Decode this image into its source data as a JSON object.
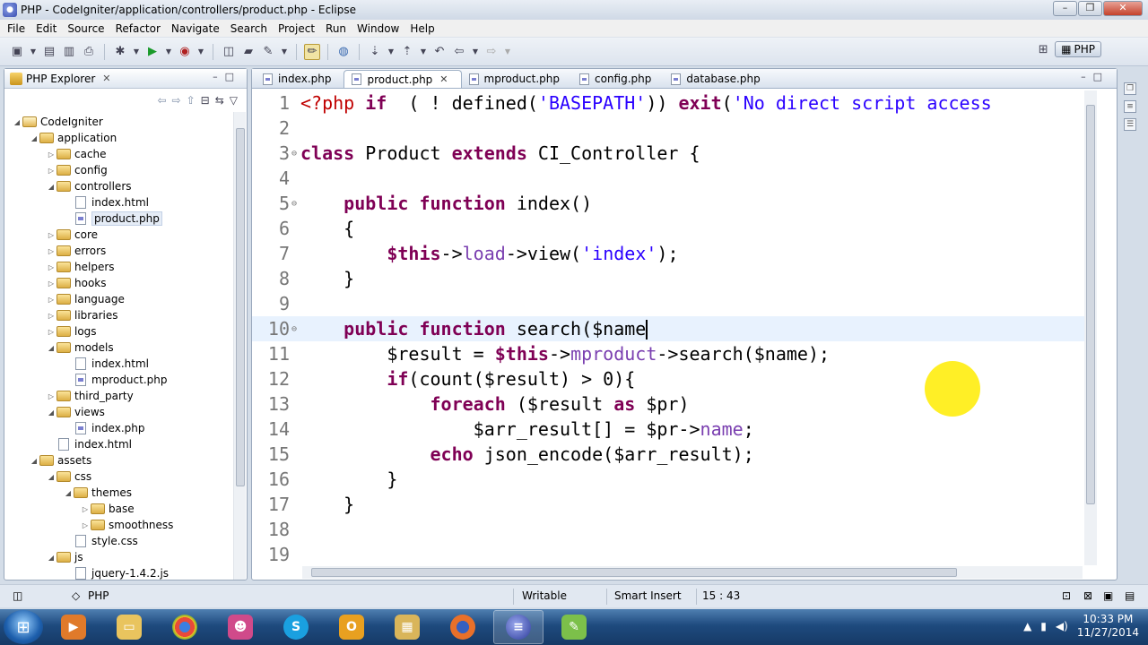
{
  "window": {
    "title": "PHP - CodeIgniter/application/controllers/product.php - Eclipse"
  },
  "menu": [
    "File",
    "Edit",
    "Source",
    "Refactor",
    "Navigate",
    "Search",
    "Project",
    "Run",
    "Window",
    "Help"
  ],
  "perspective": {
    "label": "PHP"
  },
  "explorer": {
    "tab_label": "PHP Explorer",
    "tree": [
      {
        "label": "CodeIgniter",
        "depth": 0,
        "type": "project",
        "expanded": true
      },
      {
        "label": "application",
        "depth": 1,
        "type": "folder",
        "expanded": true
      },
      {
        "label": "cache",
        "depth": 2,
        "type": "folder"
      },
      {
        "label": "config",
        "depth": 2,
        "type": "folder"
      },
      {
        "label": "controllers",
        "depth": 2,
        "type": "folder",
        "expanded": true
      },
      {
        "label": "index.html",
        "depth": 3,
        "type": "file"
      },
      {
        "label": "product.php",
        "depth": 3,
        "type": "php",
        "selected": true
      },
      {
        "label": "core",
        "depth": 2,
        "type": "folder"
      },
      {
        "label": "errors",
        "depth": 2,
        "type": "folder"
      },
      {
        "label": "helpers",
        "depth": 2,
        "type": "folder"
      },
      {
        "label": "hooks",
        "depth": 2,
        "type": "folder"
      },
      {
        "label": "language",
        "depth": 2,
        "type": "folder"
      },
      {
        "label": "libraries",
        "depth": 2,
        "type": "folder"
      },
      {
        "label": "logs",
        "depth": 2,
        "type": "folder"
      },
      {
        "label": "models",
        "depth": 2,
        "type": "folder",
        "expanded": true
      },
      {
        "label": "index.html",
        "depth": 3,
        "type": "file"
      },
      {
        "label": "mproduct.php",
        "depth": 3,
        "type": "php"
      },
      {
        "label": "third_party",
        "depth": 2,
        "type": "folder"
      },
      {
        "label": "views",
        "depth": 2,
        "type": "folder",
        "expanded": true
      },
      {
        "label": "index.php",
        "depth": 3,
        "type": "php"
      },
      {
        "label": "index.html",
        "depth": 2,
        "type": "file"
      },
      {
        "label": "assets",
        "depth": 1,
        "type": "folder",
        "expanded": true
      },
      {
        "label": "css",
        "depth": 2,
        "type": "folder",
        "expanded": true
      },
      {
        "label": "themes",
        "depth": 3,
        "type": "folder",
        "expanded": true
      },
      {
        "label": "base",
        "depth": 4,
        "type": "folder"
      },
      {
        "label": "smoothness",
        "depth": 4,
        "type": "folder"
      },
      {
        "label": "style.css",
        "depth": 3,
        "type": "file"
      },
      {
        "label": "js",
        "depth": 2,
        "type": "folder",
        "expanded": true
      },
      {
        "label": "jquery-1.4.2.js",
        "depth": 3,
        "type": "file"
      }
    ]
  },
  "editor": {
    "tabs": [
      {
        "label": "index.php",
        "active": false
      },
      {
        "label": "product.php",
        "active": true
      },
      {
        "label": "mproduct.php",
        "active": false
      },
      {
        "label": "config.php",
        "active": false
      },
      {
        "label": "database.php",
        "active": false
      }
    ],
    "current_line": 10,
    "lines": [
      {
        "n": "1",
        "fold": "",
        "tokens": [
          [
            "phptag",
            "<?php "
          ],
          [
            "kw",
            "if"
          ],
          [
            "",
            "  ( ! defined("
          ],
          [
            "str",
            "'BASEPATH'"
          ],
          [
            "",
            ")) "
          ],
          [
            "kw",
            "exit"
          ],
          [
            "",
            "("
          ],
          [
            "str",
            "'No direct script access"
          ]
        ]
      },
      {
        "n": "2",
        "fold": "",
        "tokens": []
      },
      {
        "n": "3",
        "fold": "⊖",
        "tokens": [
          [
            "kw",
            "class"
          ],
          [
            "",
            " Product "
          ],
          [
            "kw",
            "extends"
          ],
          [
            "",
            " CI_Controller {"
          ]
        ]
      },
      {
        "n": "4",
        "fold": "",
        "tokens": []
      },
      {
        "n": "5",
        "fold": "⊖",
        "tokens": [
          [
            "",
            "    "
          ],
          [
            "kw",
            "public"
          ],
          [
            "",
            " "
          ],
          [
            "kw",
            "function"
          ],
          [
            "",
            " index()"
          ]
        ]
      },
      {
        "n": "6",
        "fold": "",
        "tokens": [
          [
            "",
            "    {"
          ]
        ]
      },
      {
        "n": "7",
        "fold": "",
        "tokens": [
          [
            "",
            "        "
          ],
          [
            "thisv",
            "$this"
          ],
          [
            "",
            "->"
          ],
          [
            "call",
            "load"
          ],
          [
            "",
            "->view("
          ],
          [
            "str",
            "'index'"
          ],
          [
            "",
            ");"
          ]
        ]
      },
      {
        "n": "8",
        "fold": "",
        "tokens": [
          [
            "",
            "    }"
          ]
        ]
      },
      {
        "n": "9",
        "fold": "",
        "tokens": []
      },
      {
        "n": "10",
        "fold": "⊖",
        "tokens": [
          [
            "",
            "    "
          ],
          [
            "kw",
            "public"
          ],
          [
            "",
            " "
          ],
          [
            "kw",
            "function"
          ],
          [
            "",
            " search($name"
          ],
          [
            "caret",
            ""
          ],
          [
            ") {"
          ]
        ]
      },
      {
        "n": "11",
        "fold": "",
        "tokens": [
          [
            "",
            "        $result = "
          ],
          [
            "thisv",
            "$this"
          ],
          [
            "",
            "->"
          ],
          [
            "call",
            "mproduct"
          ],
          [
            "",
            "->search($name);"
          ]
        ]
      },
      {
        "n": "12",
        "fold": "",
        "tokens": [
          [
            "",
            "        "
          ],
          [
            "kw",
            "if"
          ],
          [
            "",
            "(count($result) > 0){"
          ]
        ]
      },
      {
        "n": "13",
        "fold": "",
        "tokens": [
          [
            "",
            "            "
          ],
          [
            "kw",
            "foreach"
          ],
          [
            "",
            " ($result "
          ],
          [
            "kw",
            "as"
          ],
          [
            "",
            " $pr)"
          ]
        ]
      },
      {
        "n": "14",
        "fold": "",
        "tokens": [
          [
            "",
            "                $arr_result[] = $pr->"
          ],
          [
            "call",
            "name"
          ],
          [
            "",
            ";"
          ]
        ]
      },
      {
        "n": "15",
        "fold": "",
        "tokens": [
          [
            "",
            "            "
          ],
          [
            "kw",
            "echo"
          ],
          [
            "",
            " json_encode($arr_result);"
          ]
        ]
      },
      {
        "n": "16",
        "fold": "",
        "tokens": [
          [
            "",
            "        }"
          ]
        ]
      },
      {
        "n": "17",
        "fold": "",
        "tokens": [
          [
            "",
            "    }"
          ]
        ]
      },
      {
        "n": "18",
        "fold": "",
        "tokens": []
      },
      {
        "n": "19",
        "fold": "",
        "tokens": []
      }
    ]
  },
  "status": {
    "language": "PHP",
    "writable": "Writable",
    "insert_mode": "Smart Insert",
    "position": "15 : 43"
  },
  "taskbar": {
    "clock_time": "10:33 PM",
    "clock_date": "11/27/2014"
  },
  "colors": {
    "keyword": "#7f0055",
    "string": "#2a00ff",
    "php_tag": "#c00000",
    "current_line": "#e8f2fe"
  }
}
